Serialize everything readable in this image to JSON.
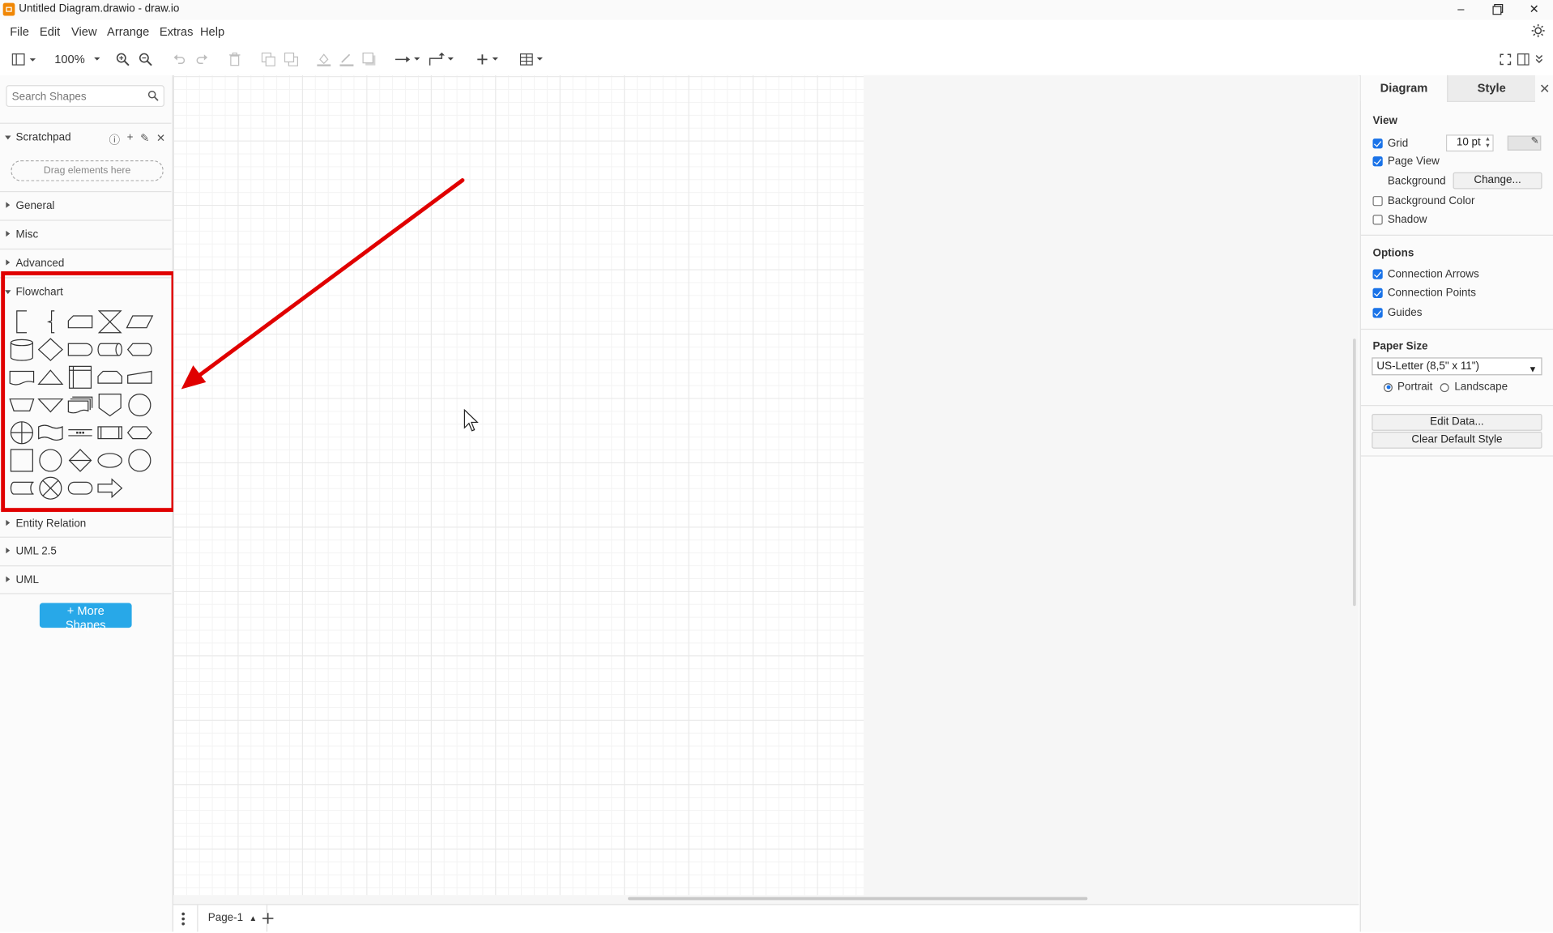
{
  "window": {
    "title": "Untitled Diagram.drawio - draw.io",
    "controls": [
      "minimize-icon",
      "maximize-icon",
      "close-icon"
    ]
  },
  "menu": {
    "items": [
      "File",
      "Edit",
      "View",
      "Arrange",
      "Extras",
      "Help"
    ]
  },
  "toolbar": {
    "zoom": "100%",
    "icons": [
      "sidebar-toggle-icon",
      "zoom-in-icon",
      "zoom-out-icon",
      "undo-icon",
      "redo-icon",
      "delete-icon",
      "to-front-icon",
      "to-back-icon",
      "fill-color-icon",
      "line-color-icon",
      "shadow-icon",
      "connection-icon",
      "waypoints-icon",
      "insert-icon",
      "table-icon",
      "fullscreen-icon",
      "format-panel-icon",
      "collapse-icon"
    ]
  },
  "sidebar": {
    "search_placeholder": "Search Shapes",
    "scratchpad": {
      "label": "Scratchpad",
      "drop_hint": "Drag elements here",
      "icons": [
        "help-icon",
        "add-icon",
        "edit-icon",
        "close-icon"
      ]
    },
    "sections": [
      {
        "label": "General",
        "expanded": false
      },
      {
        "label": "Misc",
        "expanded": false
      },
      {
        "label": "Advanced",
        "expanded": false
      },
      {
        "label": "Flowchart",
        "expanded": true
      },
      {
        "label": "Entity Relation",
        "expanded": false
      },
      {
        "label": "UML 2.5",
        "expanded": false
      },
      {
        "label": "UML",
        "expanded": false
      }
    ],
    "more_shapes": "+ More Shapes",
    "flowchart_shapes": [
      "annotation-1",
      "annotation-2",
      "card",
      "collate",
      "data",
      "database",
      "decision",
      "delay",
      "direct-data",
      "display",
      "document",
      "extract",
      "internal-storage",
      "loop-limit",
      "manual-input",
      "manual-operation",
      "merge",
      "multi-document",
      "off-page-reference",
      "on-page-reference",
      "or",
      "paper-tape",
      "parallel-mode",
      "predefined-process",
      "preparation",
      "process",
      "start-1",
      "sort",
      "start-2",
      "start-end",
      "stored-data",
      "summing-function",
      "terminator",
      "transfer"
    ]
  },
  "pages": {
    "current": "Page-1"
  },
  "format_panel": {
    "tabs": [
      "Diagram",
      "Style"
    ],
    "active_tab": "Diagram",
    "view": {
      "heading": "View",
      "grid_label": "Grid",
      "grid_checked": true,
      "grid_size": "10 pt",
      "page_view_label": "Page View",
      "page_view_checked": true,
      "background_label": "Background",
      "change_button": "Change...",
      "background_color_label": "Background Color",
      "background_color_checked": false,
      "shadow_label": "Shadow",
      "shadow_checked": false
    },
    "options": {
      "heading": "Options",
      "connection_arrows": "Connection Arrows",
      "connection_points": "Connection Points",
      "guides": "Guides"
    },
    "paper": {
      "heading": "Paper Size",
      "selected": "US-Letter (8,5\" x 11\")",
      "portrait": "Portrait",
      "landscape": "Landscape",
      "orientation": "Portrait"
    },
    "edit_data": "Edit Data...",
    "clear_default_style": "Clear Default Style"
  },
  "annotation": {
    "highlight_color": "#e00000",
    "arrow_color": "#e00000"
  }
}
